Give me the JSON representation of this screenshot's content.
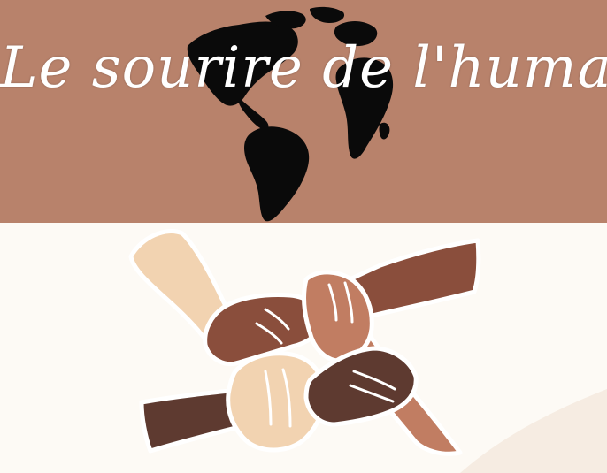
{
  "title": "Le sourire de l'humanité",
  "colors": {
    "banner": "#b8826b",
    "background": "#fdfaf5",
    "globe": "#0a0a0a",
    "skin_light": "#f2d3b1",
    "skin_tan": "#c17d62",
    "skin_brown": "#8a4e3c",
    "skin_dark": "#5e3a30",
    "outline": "#ffffff"
  },
  "icons": [
    "globe-icon",
    "linked-hands-icon"
  ]
}
